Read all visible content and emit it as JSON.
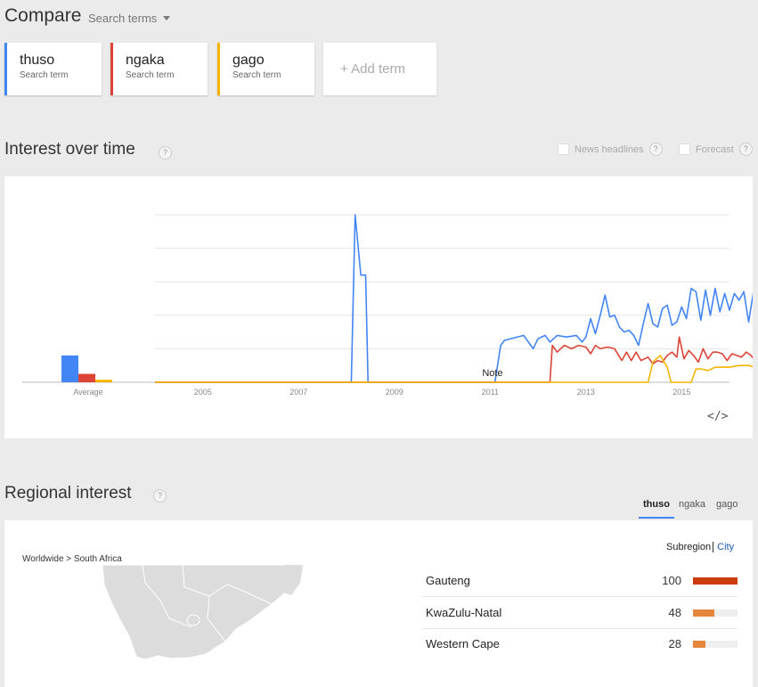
{
  "compare": {
    "title": "Compare",
    "search_terms_label": "Search terms"
  },
  "terms": [
    {
      "name": "thuso",
      "sub": "Search term",
      "color": "#4285f4"
    },
    {
      "name": "ngaka",
      "sub": "Search term",
      "color": "#db4437"
    },
    {
      "name": "gago",
      "sub": "Search term",
      "color": "#f4b400"
    }
  ],
  "add_term_label": "+ Add term",
  "interest": {
    "title": "Interest over time",
    "help": "?",
    "news_headlines_label": "News headlines",
    "forecast_label": "Forecast",
    "embed_label": "</>"
  },
  "chart_data": {
    "type": "line",
    "x_ticks": [
      "2005",
      "2007",
      "2009",
      "2011",
      "2013",
      "2015"
    ],
    "average_label": "Average",
    "note_label": "Note",
    "ylim": [
      0,
      100
    ],
    "averages": [
      {
        "name": "thuso",
        "value": 16,
        "color": "#4285f4"
      },
      {
        "name": "ngaka",
        "value": 5,
        "color": "#db4437"
      },
      {
        "name": "gago",
        "value": 1.5,
        "color": "#f4b400"
      }
    ],
    "series": [
      {
        "name": "thuso",
        "color": "#4285f4",
        "points": [
          [
            2004.0,
            0
          ],
          [
            2008.1,
            0
          ],
          [
            2008.18,
            100
          ],
          [
            2008.3,
            64
          ],
          [
            2008.4,
            64
          ],
          [
            2008.45,
            0
          ],
          [
            2011.1,
            0
          ],
          [
            2011.22,
            22
          ],
          [
            2011.3,
            25
          ],
          [
            2011.7,
            28
          ],
          [
            2011.9,
            20
          ],
          [
            2012.0,
            26
          ],
          [
            2012.15,
            28
          ],
          [
            2012.25,
            24
          ],
          [
            2012.4,
            28
          ],
          [
            2012.6,
            27
          ],
          [
            2012.8,
            28
          ],
          [
            2012.92,
            24
          ],
          [
            2013.0,
            27
          ],
          [
            2013.1,
            38
          ],
          [
            2013.2,
            29
          ],
          [
            2013.3,
            40
          ],
          [
            2013.4,
            52
          ],
          [
            2013.5,
            39
          ],
          [
            2013.6,
            40
          ],
          [
            2013.7,
            33
          ],
          [
            2013.8,
            30
          ],
          [
            2013.9,
            31
          ],
          [
            2014.0,
            28
          ],
          [
            2014.1,
            22
          ],
          [
            2014.2,
            35
          ],
          [
            2014.3,
            47
          ],
          [
            2014.4,
            35
          ],
          [
            2014.5,
            33
          ],
          [
            2014.6,
            44
          ],
          [
            2014.7,
            46
          ],
          [
            2014.8,
            34
          ],
          [
            2014.9,
            36
          ],
          [
            2015.0,
            45
          ],
          [
            2015.1,
            38
          ],
          [
            2015.2,
            56
          ],
          [
            2015.3,
            54
          ],
          [
            2015.4,
            37
          ],
          [
            2015.5,
            55
          ],
          [
            2015.6,
            40
          ],
          [
            2015.7,
            56
          ],
          [
            2015.8,
            42
          ],
          [
            2015.9,
            53
          ],
          [
            2016.0,
            43
          ],
          [
            2016.1,
            53
          ],
          [
            2016.2,
            49
          ],
          [
            2016.3,
            54
          ],
          [
            2016.4,
            36
          ],
          [
            2016.5,
            54
          ],
          [
            2016.6,
            38
          ],
          [
            2016.7,
            46
          ],
          [
            2016.8,
            46
          ]
        ]
      },
      {
        "name": "ngaka",
        "color": "#db4437",
        "points": [
          [
            2004.0,
            0
          ],
          [
            2012.25,
            0
          ],
          [
            2012.3,
            22
          ],
          [
            2012.4,
            18
          ],
          [
            2012.55,
            22
          ],
          [
            2012.7,
            20
          ],
          [
            2012.85,
            22
          ],
          [
            2013.0,
            21
          ],
          [
            2013.1,
            17
          ],
          [
            2013.2,
            22
          ],
          [
            2013.3,
            20
          ],
          [
            2013.45,
            21
          ],
          [
            2013.6,
            20
          ],
          [
            2013.75,
            13
          ],
          [
            2013.85,
            18
          ],
          [
            2013.95,
            13
          ],
          [
            2014.05,
            18
          ],
          [
            2014.15,
            13
          ],
          [
            2014.3,
            15
          ],
          [
            2014.4,
            11
          ],
          [
            2014.5,
            13
          ],
          [
            2014.6,
            12
          ],
          [
            2014.7,
            16
          ],
          [
            2014.8,
            18
          ],
          [
            2014.9,
            15
          ],
          [
            2014.95,
            27
          ],
          [
            2015.05,
            14
          ],
          [
            2015.15,
            19
          ],
          [
            2015.25,
            16
          ],
          [
            2015.35,
            12
          ],
          [
            2015.45,
            20
          ],
          [
            2015.55,
            14
          ],
          [
            2015.65,
            18
          ],
          [
            2015.75,
            18
          ],
          [
            2015.85,
            17
          ],
          [
            2015.95,
            13
          ],
          [
            2016.05,
            17
          ],
          [
            2016.15,
            16
          ],
          [
            2016.25,
            15
          ],
          [
            2016.35,
            18
          ],
          [
            2016.45,
            16
          ],
          [
            2016.55,
            12
          ],
          [
            2016.65,
            18
          ],
          [
            2016.75,
            11
          ],
          [
            2016.8,
            12
          ]
        ]
      },
      {
        "name": "gago",
        "color": "#f4b400",
        "points": [
          [
            2004.0,
            0
          ],
          [
            2014.3,
            0
          ],
          [
            2014.4,
            12
          ],
          [
            2014.55,
            16
          ],
          [
            2014.7,
            9
          ],
          [
            2014.78,
            0
          ],
          [
            2015.2,
            0
          ],
          [
            2015.3,
            8
          ],
          [
            2015.4,
            8
          ],
          [
            2015.55,
            7
          ],
          [
            2015.7,
            9
          ],
          [
            2015.85,
            9
          ],
          [
            2016.0,
            9
          ],
          [
            2016.2,
            10
          ],
          [
            2016.4,
            10
          ],
          [
            2016.55,
            9
          ],
          [
            2016.65,
            5
          ],
          [
            2016.75,
            0
          ],
          [
            2016.8,
            0
          ]
        ]
      }
    ]
  },
  "regional": {
    "title": "Regional interest",
    "help": "?",
    "tabs": [
      "thuso",
      "ngaka",
      "gago"
    ],
    "subregion_label": "Subregion",
    "city_label": "City",
    "breadcrumb": "Worldwide > South Africa",
    "rows": [
      {
        "name": "Gauteng",
        "value": 100,
        "color": "#cc3d0b"
      },
      {
        "name": "KwaZulu-Natal",
        "value": 48,
        "color": "#e4873d"
      },
      {
        "name": "Western Cape",
        "value": 28,
        "color": "#e4873d"
      }
    ]
  }
}
